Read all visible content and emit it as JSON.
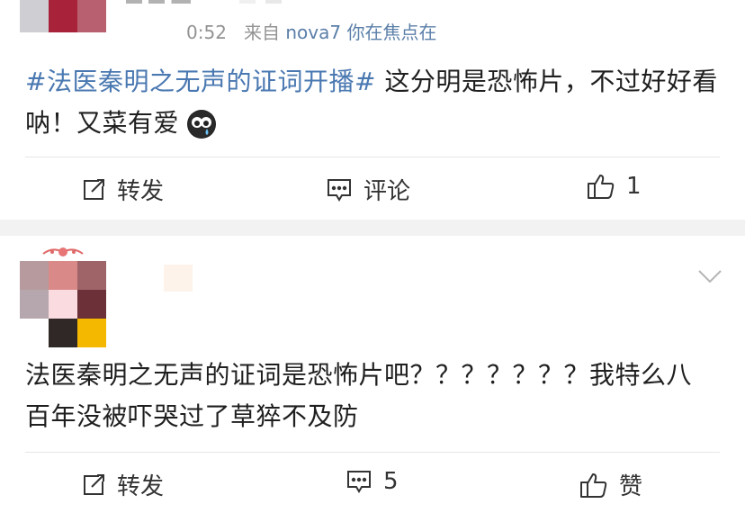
{
  "post1": {
    "time": "0:52",
    "source_prefix": "来自",
    "source_device": "nova7 你在焦点在",
    "topic": "#法医秦明之无声的证词开播#",
    "text_after_topic": " 这分明是恐怖片，不过好好看呐！又菜有爱",
    "actions": {
      "repost": "转发",
      "comment": "评论",
      "like_count": "1"
    }
  },
  "post2": {
    "text": "法医秦明之无声的证词是恐怖片吧？？？？？？？我特么八百年没被吓哭过了草猝不及防",
    "actions": {
      "repost": "转发",
      "comment_count": "5",
      "like": "赞"
    }
  },
  "colors": {
    "topic": "#4a78b1",
    "meta": "#939393",
    "divider": "#e6e6e6",
    "band": "#f2f2f2"
  },
  "icons": [
    "repost-icon",
    "comment-icon",
    "thumbs-up-icon",
    "chevron-down-icon",
    "crying-emoji-icon"
  ]
}
